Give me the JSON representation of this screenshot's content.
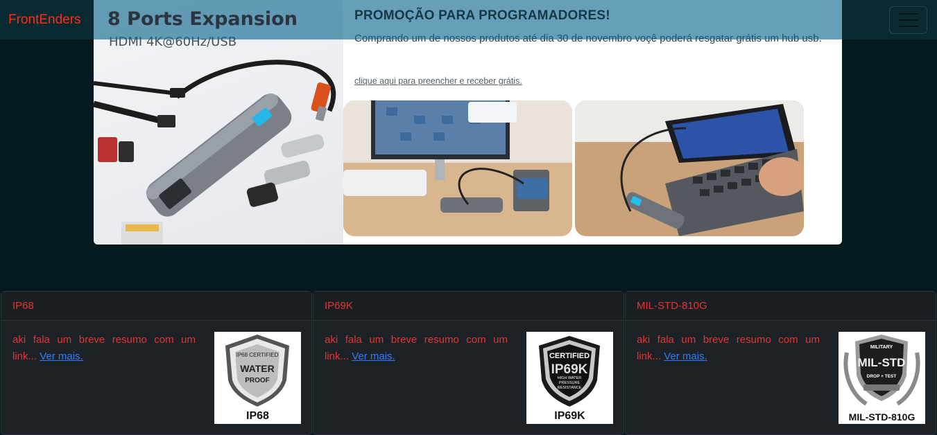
{
  "navbar": {
    "brand": "FrontEnders",
    "toggle_icon": "hamburger-menu-icon"
  },
  "promo": {
    "image_title": "8 Ports Expansion",
    "image_subtitle": "HDMI 4K@60Hz/USB",
    "title": "PROMOÇÃO PARA PROGRAMADORES!",
    "text": "Comprando um de nossos produtos até dia 30 de novembro voçê poderá resgatar grátis um hub usb.",
    "link": "clique aqui para preencher e receber grátis."
  },
  "cards": [
    {
      "header": "IP68",
      "summary": "aki fala um breve resumo com um link...",
      "more": "Ver mais.",
      "badge": {
        "top": "IP68 CERTIFIED",
        "line1": "WATER",
        "line2": "PROOF",
        "caption": "IP68"
      }
    },
    {
      "header": "IP69K",
      "summary": "aki fala um breve resumo com um link...",
      "more": "Ver mais.",
      "badge": {
        "top": "CERTIFIED",
        "line1": "IP69K",
        "line2": "HIGH WATER PRESSURE RESISTANCE",
        "caption": "IP69K"
      }
    },
    {
      "header": "MIL-STD-810G",
      "summary": "aki fala um breve resumo com um link...",
      "more": "Ver mais.",
      "badge": {
        "top": "MILITARY",
        "line1": "MIL-STD",
        "line2": "DROP + TEST",
        "caption": "MIL-STD-810G"
      }
    }
  ],
  "colors": {
    "page_bg": "#041a1f",
    "brand": "#ff2a1a",
    "card_text": "#e33434",
    "link": "#2f7cff"
  }
}
